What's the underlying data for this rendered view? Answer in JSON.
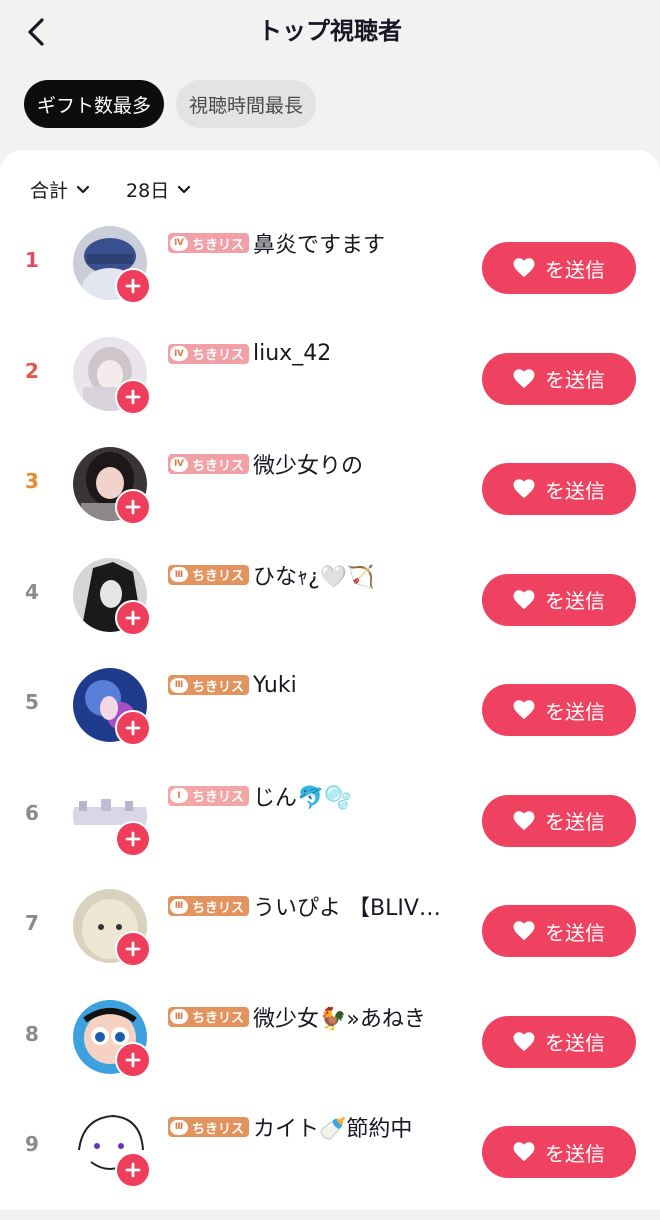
{
  "header": {
    "title": "トップ視聴者"
  },
  "tabs": [
    {
      "label": "ギフト数最多",
      "active": true
    },
    {
      "label": "視聴時間最長",
      "active": false
    }
  ],
  "filters": {
    "period": "合計",
    "range": "28日"
  },
  "badge_label": "ちきリス",
  "send_label": "を送信",
  "colors": {
    "accent": "#ef4260",
    "rank1": "#e34a5f",
    "rank2": "#e2574e",
    "rank3": "#e8892c",
    "rank_other": "#8a8b91"
  },
  "viewers": [
    {
      "rank": "1",
      "name": "鼻炎ですます",
      "badge_level": "Ⅳ",
      "tier": "tier4",
      "avatar": "blue-cap"
    },
    {
      "rank": "2",
      "name": "liux_42",
      "badge_level": "Ⅳ",
      "tier": "tier4",
      "avatar": "anime-girl"
    },
    {
      "rank": "3",
      "name": "微少女りの",
      "badge_level": "Ⅳ",
      "tier": "tier4",
      "avatar": "selfie"
    },
    {
      "rank": "4",
      "name": "ひなｬ¿🤍🏹",
      "badge_level": "Ⅲ",
      "tier": "tier3",
      "avatar": "dark-art"
    },
    {
      "rank": "5",
      "name": "Yuki",
      "badge_level": "Ⅲ",
      "tier": "tier3",
      "avatar": "blue-art"
    },
    {
      "rank": "6",
      "name": "じん🐬🫧",
      "badge_level": "Ⅰ",
      "tier": "tier1",
      "avatar": "winter"
    },
    {
      "rank": "7",
      "name": "ういぴよ 【BLIV…",
      "badge_level": "Ⅲ",
      "tier": "tier3",
      "avatar": "plush"
    },
    {
      "rank": "8",
      "name": "微少女🐓»あねき",
      "badge_level": "Ⅲ",
      "tier": "tier3",
      "avatar": "cartoon"
    },
    {
      "rank": "9",
      "name": "カイト🍼節約中",
      "badge_level": "Ⅲ",
      "tier": "tier3",
      "avatar": "doodle"
    }
  ]
}
